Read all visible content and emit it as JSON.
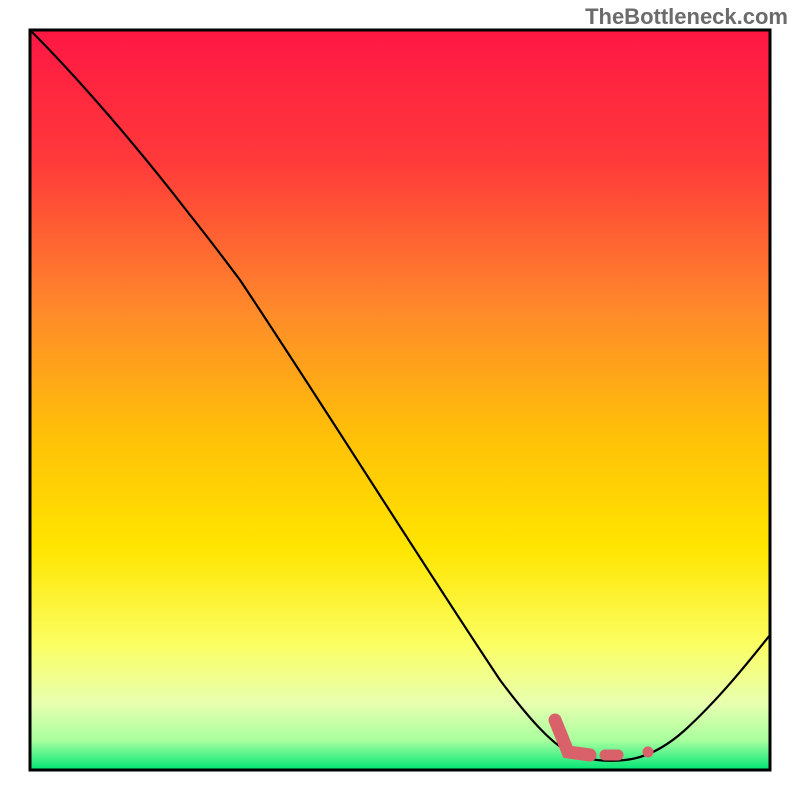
{
  "attribution": "TheBottleneck.com",
  "chart_data": {
    "type": "line",
    "title": "",
    "xlabel": "",
    "ylabel": "",
    "xlim": [
      0,
      100
    ],
    "ylim": [
      0,
      100
    ],
    "grid": false,
    "gradient": {
      "top_color": "#ff1744",
      "upper_mid_color": "#ff6a2a",
      "mid_color": "#ffd500",
      "lower_mid_color": "#faff66",
      "near_bottom_color": "#d8ffb3",
      "bottom_color": "#00e676"
    },
    "series": [
      {
        "name": "main-curve",
        "stroke": "#000000",
        "stroke_width": 2,
        "x": [
          0,
          5,
          10,
          15,
          20,
          25,
          30,
          35,
          40,
          45,
          50,
          55,
          60,
          65,
          70,
          75,
          80,
          82,
          85,
          90,
          95,
          100
        ],
        "y": [
          100,
          93,
          86,
          79,
          73,
          68,
          62,
          54,
          46,
          38,
          30,
          22,
          15,
          9,
          5,
          2,
          1,
          1,
          2,
          5,
          10,
          17
        ]
      },
      {
        "name": "highlight-segment",
        "stroke": "#d9626a",
        "stroke_width": 10,
        "dash": [
          14,
          6,
          4,
          6,
          4,
          20
        ],
        "x": [
          70,
          74,
          76,
          80,
          85
        ],
        "y": [
          5,
          1.2,
          1,
          1,
          1.5
        ]
      },
      {
        "name": "highlight-dot",
        "type": "scatter",
        "stroke": "#d9626a",
        "x": [
          85
        ],
        "y": [
          1.5
        ]
      }
    ]
  }
}
